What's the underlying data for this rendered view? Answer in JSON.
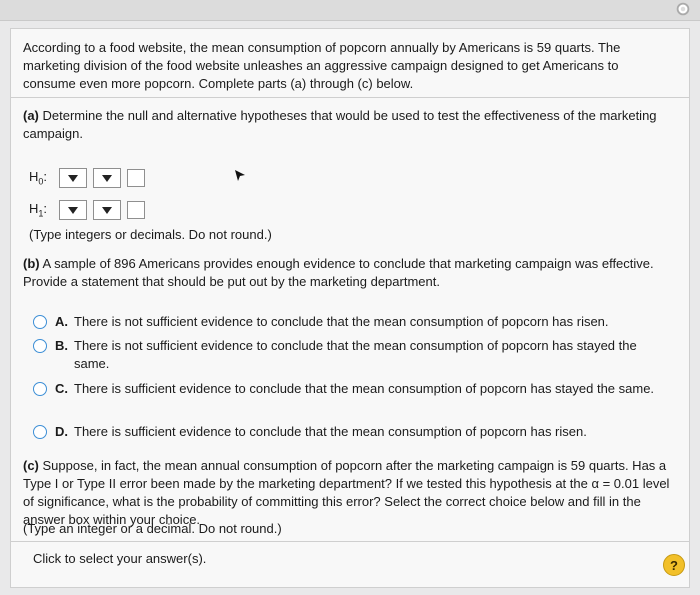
{
  "intro_text": "According to a food website, the mean consumption of popcorn annually by Americans is 59 quarts. The marketing division of the food website unleashes an aggressive campaign designed to get Americans to consume even more popcorn. Complete parts (a) through (c) below.",
  "part_a": {
    "letter": "(a)",
    "prompt": " Determine the null and alternative hypotheses that would be used to test the effectiveness of the marketing campaign.",
    "h0_label": "H",
    "h0_sub": "0",
    "h1_label": "H",
    "h1_sub": "1",
    "hint": "(Type integers or decimals. Do not round.)"
  },
  "part_b": {
    "letter": "(b)",
    "prompt": " A sample of 896 Americans provides enough evidence to conclude that marketing campaign was effective. Provide a statement that should be put out by the marketing department.",
    "options": [
      {
        "letter": "A.",
        "text": "There is not sufficient evidence to conclude that the mean consumption of popcorn has risen."
      },
      {
        "letter": "B.",
        "text": "There is not sufficient evidence to conclude that the mean consumption of popcorn has stayed the same."
      },
      {
        "letter": "C.",
        "text": "There is sufficient evidence to conclude that the mean consumption of popcorn has stayed the same."
      },
      {
        "letter": "D.",
        "text": "There is sufficient evidence to conclude that the mean consumption of popcorn has risen."
      }
    ]
  },
  "part_c": {
    "letter": "(c)",
    "prompt": " Suppose, in fact, the mean annual consumption of popcorn after the marketing campaign is 59 quarts. Has a Type I or Type II error been made by the marketing department? If we tested this hypothesis at the α = 0.01 level of significance, what is the probability of committing this error? Select the correct choice below and fill in the answer box within your choice.",
    "hint": "(Type an integer or a decimal. Do not round.)"
  },
  "footer": {
    "click_prompt": "Click to select your answer(s).",
    "help_label": "?"
  },
  "colors": {
    "radio_border": "#3d8fd6",
    "help_bg": "#f2c029"
  }
}
